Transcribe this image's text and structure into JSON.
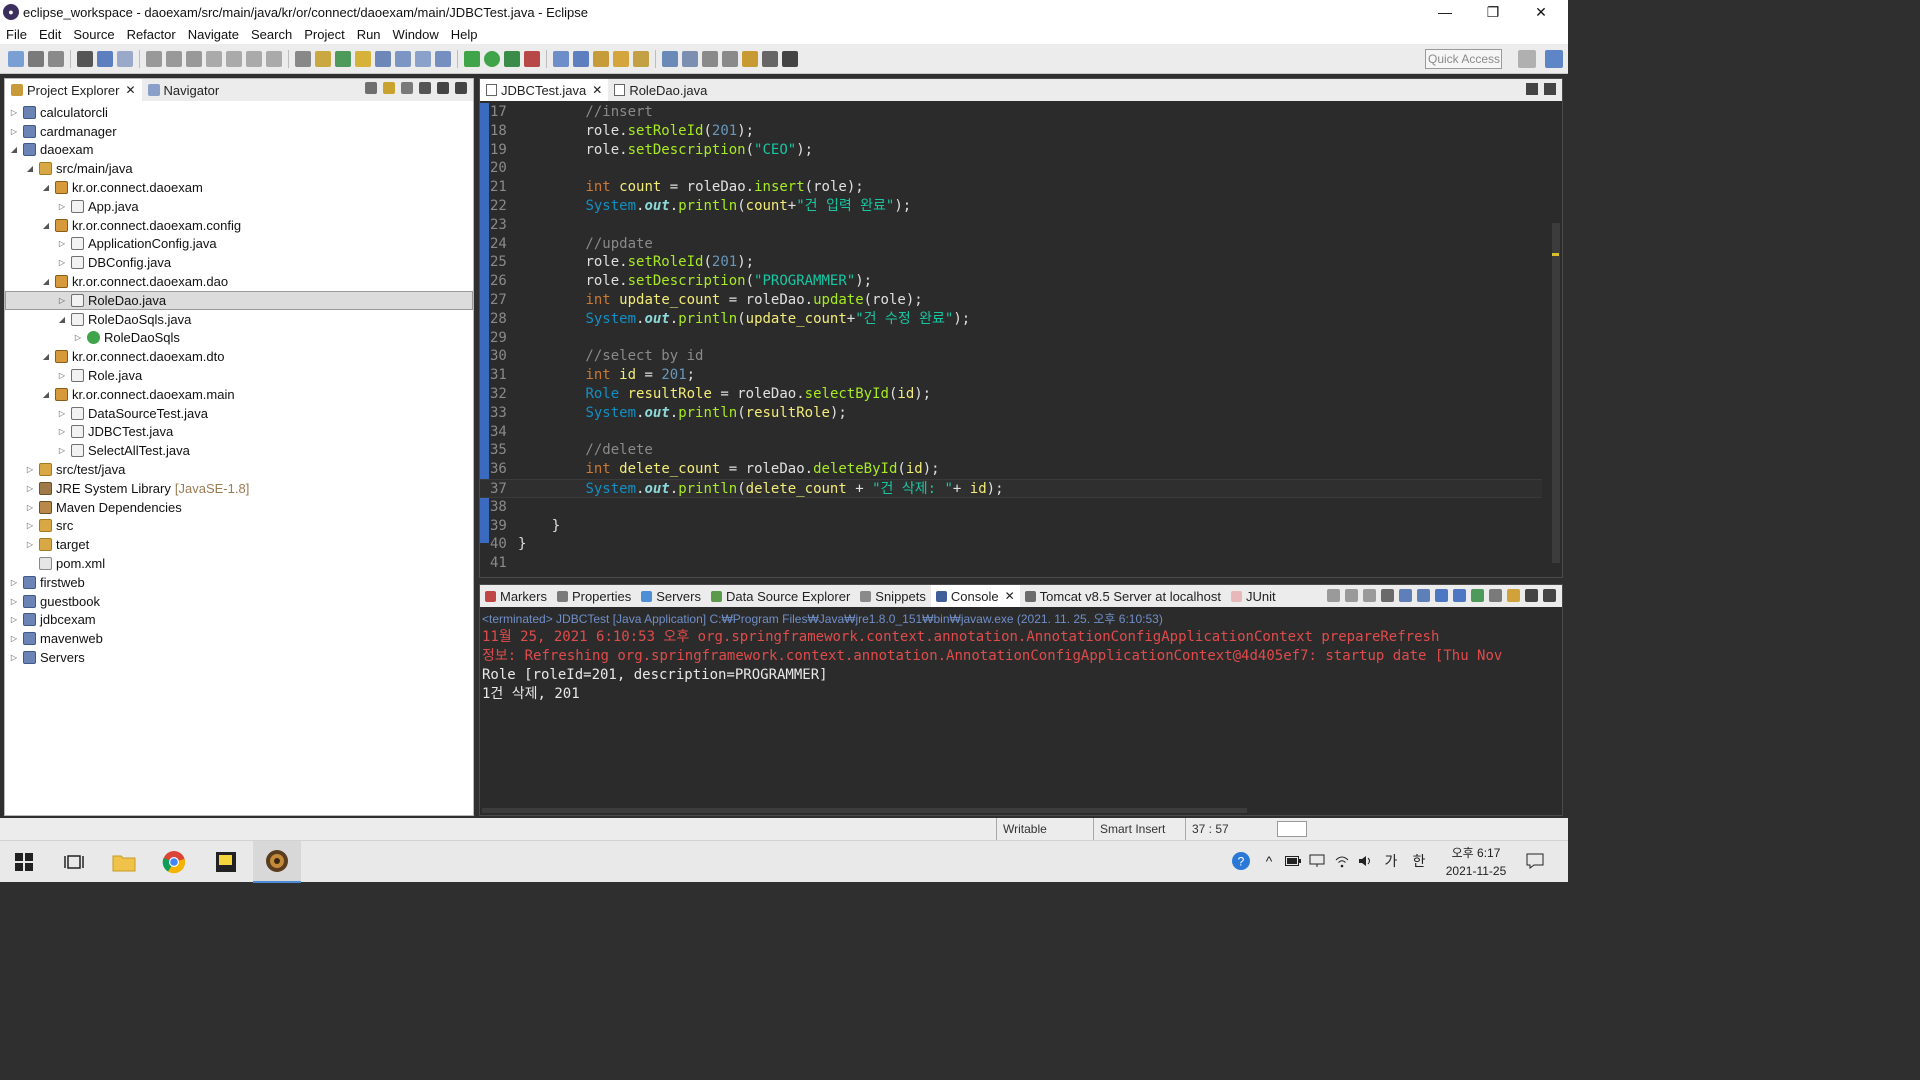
{
  "window": {
    "title": "eclipse_workspace - daoexam/src/main/java/kr/or/connect/daoexam/main/JDBCTest.java - Eclipse",
    "minimize": "—",
    "restore": "❐",
    "close": "✕"
  },
  "menu": [
    "File",
    "Edit",
    "Source",
    "Refactor",
    "Navigate",
    "Search",
    "Project",
    "Run",
    "Window",
    "Help"
  ],
  "toolbar": {
    "quick_access_placeholder": "Quick Access"
  },
  "project_explorer": {
    "tabs": [
      {
        "label": "Project Explorer",
        "close": "✕"
      },
      {
        "label": "Navigator"
      }
    ],
    "tree": [
      {
        "label": "calculatorcli",
        "expanded": false
      },
      {
        "label": "cardmanager",
        "expanded": false
      },
      {
        "label": "daoexam",
        "expanded": true
      },
      {
        "label": "src/main/java",
        "expanded": true
      },
      {
        "label": "kr.or.connect.daoexam",
        "expanded": true
      },
      {
        "label": "App.java",
        "expanded": false
      },
      {
        "label": "kr.or.connect.daoexam.config",
        "expanded": true
      },
      {
        "label": "ApplicationConfig.java",
        "expanded": false
      },
      {
        "label": "DBConfig.java",
        "expanded": false
      },
      {
        "label": "kr.or.connect.daoexam.dao",
        "expanded": true
      },
      {
        "label": "RoleDao.java",
        "expanded": false,
        "selected": true
      },
      {
        "label": "RoleDaoSqls.java",
        "expanded": true
      },
      {
        "label": "RoleDaoSqls",
        "expanded": false
      },
      {
        "label": "kr.or.connect.daoexam.dto",
        "expanded": true
      },
      {
        "label": "Role.java",
        "expanded": false
      },
      {
        "label": "kr.or.connect.daoexam.main",
        "expanded": true
      },
      {
        "label": "DataSourceTest.java",
        "expanded": false
      },
      {
        "label": "JDBCTest.java",
        "expanded": false
      },
      {
        "label": "SelectAllTest.java",
        "expanded": false
      },
      {
        "label": "src/test/java",
        "expanded": false
      },
      {
        "label": "JRE System Library",
        "suffix": "[JavaSE-1.8]",
        "expanded": false
      },
      {
        "label": "Maven Dependencies",
        "expanded": false
      },
      {
        "label": "src",
        "expanded": false
      },
      {
        "label": "target",
        "expanded": false
      },
      {
        "label": "pom.xml"
      },
      {
        "label": "firstweb",
        "expanded": false
      },
      {
        "label": "guestbook",
        "expanded": false
      },
      {
        "label": "jdbcexam",
        "expanded": false
      },
      {
        "label": "mavenweb",
        "expanded": false
      },
      {
        "label": "Servers",
        "expanded": false
      }
    ]
  },
  "editor": {
    "tabs": [
      {
        "label": "JDBCTest.java",
        "close": "✕"
      },
      {
        "label": "RoleDao.java"
      }
    ],
    "current_line": "37",
    "lines": [
      {
        "n": "17",
        "t": "        //insert"
      },
      {
        "n": "18",
        "t": "        role.setRoleId(201);"
      },
      {
        "n": "19",
        "t": "        role.setDescription(\"CEO\");"
      },
      {
        "n": "20",
        "t": ""
      },
      {
        "n": "21",
        "t": "        int count = roleDao.insert(role);"
      },
      {
        "n": "22",
        "t": "        System.out.println(count+\"건 입력 완료\");"
      },
      {
        "n": "23",
        "t": ""
      },
      {
        "n": "24",
        "t": "        //update"
      },
      {
        "n": "25",
        "t": "        role.setRoleId(201);"
      },
      {
        "n": "26",
        "t": "        role.setDescription(\"PROGRAMMER\");"
      },
      {
        "n": "27",
        "t": "        int update_count = roleDao.update(role);"
      },
      {
        "n": "28",
        "t": "        System.out.println(update_count+\"건 수정 완료\");"
      },
      {
        "n": "29",
        "t": ""
      },
      {
        "n": "30",
        "t": "        //select by id"
      },
      {
        "n": "31",
        "t": "        int id = 201;"
      },
      {
        "n": "32",
        "t": "        Role resultRole = roleDao.selectById(id);"
      },
      {
        "n": "33",
        "t": "        System.out.println(resultRole);"
      },
      {
        "n": "34",
        "t": ""
      },
      {
        "n": "35",
        "t": "        //delete"
      },
      {
        "n": "36",
        "t": "        int delete_count = roleDao.deleteById(id);"
      },
      {
        "n": "37",
        "t": "        System.out.println(delete_count + \"건 삭제: \"+ id);"
      },
      {
        "n": "38",
        "t": ""
      },
      {
        "n": "39",
        "t": "    }"
      },
      {
        "n": "40",
        "t": "}"
      },
      {
        "n": "41",
        "t": ""
      }
    ]
  },
  "console_view": {
    "tabs": [
      {
        "label": "Markers"
      },
      {
        "label": "Properties"
      },
      {
        "label": "Servers"
      },
      {
        "label": "Data Source Explorer"
      },
      {
        "label": "Snippets"
      },
      {
        "label": "Console",
        "close": "✕"
      },
      {
        "label": "Tomcat v8.5 Server at localhost"
      },
      {
        "label": "JUnit"
      }
    ],
    "header": "<terminated> JDBCTest [Java Application] C:₩Program Files₩Java₩jre1.8.0_151₩bin₩javaw.exe (2021. 11. 25. 오후 6:10:53)",
    "output": [
      {
        "text": "11월 25, 2021 6:10:53 오후 org.springframework.context.annotation.AnnotationConfigApplicationContext prepareRefresh",
        "color": "#e04b4b"
      },
      {
        "text": "정보: Refreshing org.springframework.context.annotation.AnnotationConfigApplicationContext@4d405ef7: startup date [Thu Nov",
        "color": "#e04b4b"
      },
      {
        "text": "Role [roleId=201, description=PROGRAMMER]",
        "color": "#e8e8e8"
      },
      {
        "text": "1건 삭제, 201",
        "color": "#e8e8e8"
      }
    ]
  },
  "status_bar": {
    "mode": "Writable",
    "insert": "Smart Insert",
    "position": "37 : 57"
  },
  "taskbar": {
    "apps": [
      "windows-start",
      "task-view",
      "file-explorer",
      "chrome",
      "sticky-notes",
      "eclipse"
    ],
    "tray": {
      "ime": "가",
      "lang": "한"
    },
    "time": "오후 6:17",
    "date": "2021-11-25"
  },
  "colors": {
    "accent": "#4c8bd8",
    "editor_bg": "#2b2b2b",
    "error_text": "#e04b4b"
  }
}
